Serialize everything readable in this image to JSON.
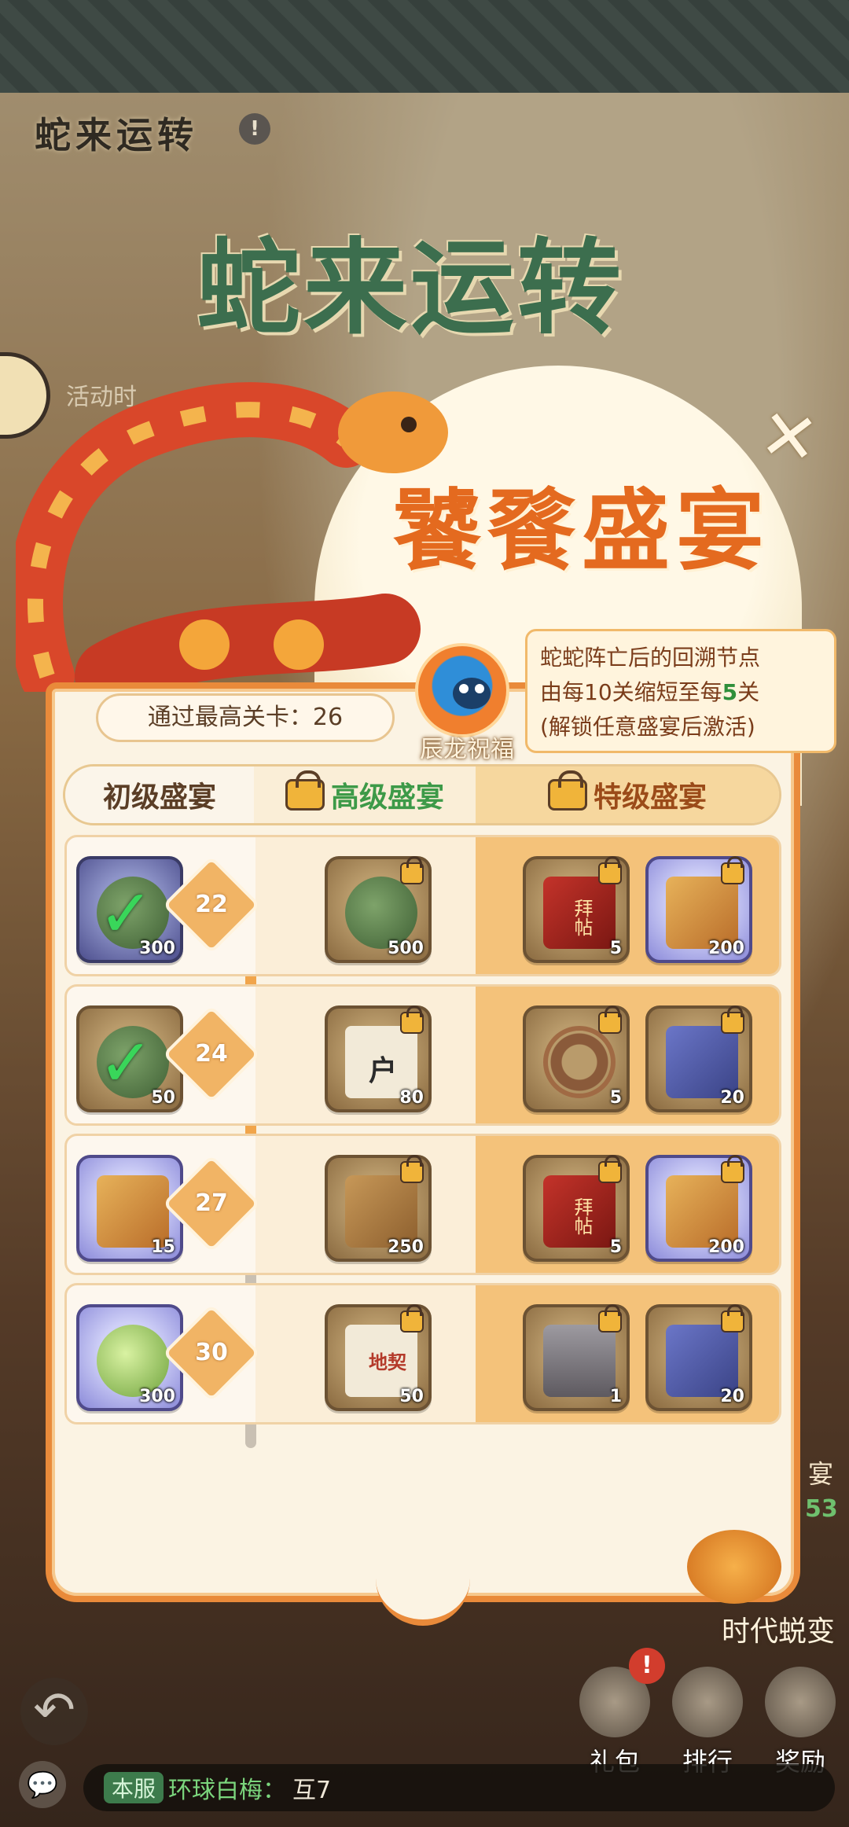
{
  "header": {
    "page_title": "蛇来运转",
    "info_badge": "!",
    "big_title": "蛇来运转",
    "activity_time_label": "活动时"
  },
  "popup": {
    "title": "饕餮盛宴",
    "close_symbol": "✕",
    "highest_level_label": "通过最高关卡：26",
    "blessing_label": "辰龙祝福",
    "tip": {
      "line1": "蛇蛇阵亡后的回溯节点",
      "line2_prefix": "由每10关缩短至每",
      "line2_highlight": "5",
      "line2_suffix": "关",
      "line3": "(解锁任意盛宴后激活)"
    },
    "tabs": [
      {
        "label": "初级盛宴"
      },
      {
        "label": "高级盛宴"
      },
      {
        "label": "特级盛宴"
      }
    ],
    "progress": 0.52,
    "rows": [
      {
        "level": "22",
        "basic": {
          "count": "300",
          "claimed": true,
          "art": "green-fruit"
        },
        "advanced": {
          "count": "500",
          "locked": true,
          "art": "green-dragon-token"
        },
        "special": [
          {
            "count": "5",
            "locked": true,
            "art": "red-invitation",
            "text": "拜帖"
          },
          {
            "count": "200",
            "locked": true,
            "art": "book"
          }
        ]
      },
      {
        "level": "24",
        "basic": {
          "count": "50",
          "claimed": true,
          "art": "green-dragon-token"
        },
        "advanced": {
          "count": "80",
          "locked": true,
          "art": "card",
          "text": "户"
        },
        "special": [
          {
            "count": "5",
            "locked": true,
            "art": "rope"
          },
          {
            "count": "20",
            "locked": true,
            "art": "scroll"
          }
        ]
      },
      {
        "level": "27",
        "basic": {
          "count": "15",
          "claimed": false,
          "art": "book"
        },
        "advanced": {
          "count": "250",
          "locked": true,
          "art": "hourglass"
        },
        "special": [
          {
            "count": "5",
            "locked": true,
            "art": "red-invitation",
            "text": "拜帖"
          },
          {
            "count": "200",
            "locked": true,
            "art": "book"
          }
        ]
      },
      {
        "level": "30",
        "basic": {
          "count": "300",
          "claimed": false,
          "art": "green-apple"
        },
        "advanced": {
          "count": "50",
          "locked": true,
          "art": "map",
          "text": "地契"
        },
        "special": [
          {
            "count": "1",
            "locked": true,
            "art": "chest"
          },
          {
            "count": "20",
            "locked": true,
            "art": "scroll"
          }
        ]
      }
    ]
  },
  "side": {
    "label_1": "宴",
    "label_2": "53",
    "era_label": "时代蜕变"
  },
  "bottom_nav": {
    "back_symbol": "↶",
    "notice_badge": "!",
    "gift_label": "礼包",
    "rank_label": "排行",
    "reward_label": "奖励"
  },
  "chat": {
    "icon": "💬",
    "channel": "本服",
    "name": "环球白梅：",
    "message": "互7"
  },
  "colors": {
    "accent_orange": "#e98a3a",
    "advanced_green": "#3d9a48",
    "title_green": "#3c6e4e",
    "banquet_orange": "#e46a1f"
  }
}
